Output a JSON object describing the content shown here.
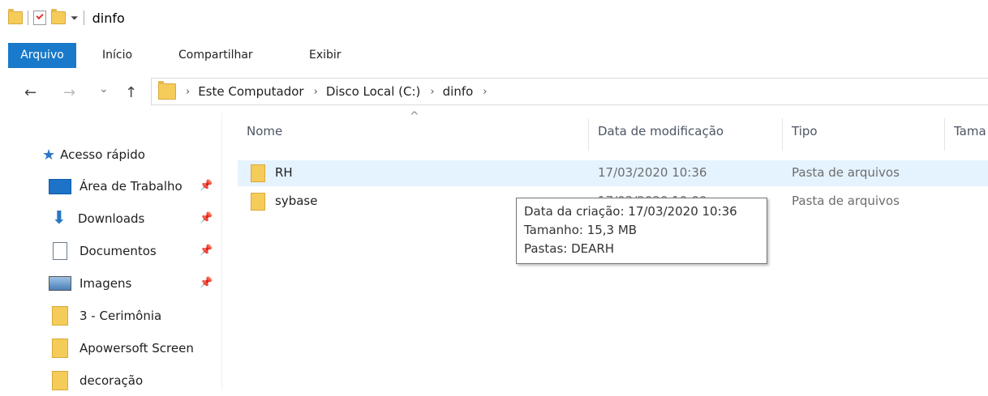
{
  "window": {
    "title": "dinfo"
  },
  "ribbon": {
    "tabs": [
      "Arquivo",
      "Início",
      "Compartilhar",
      "Exibir"
    ]
  },
  "nav_buttons": {
    "back": "←",
    "forward": "→",
    "recent": "⌄",
    "up": "↑"
  },
  "breadcrumb": [
    "Este Computador",
    "Disco Local (C:)",
    "dinfo"
  ],
  "breadcrumb_sep": "›",
  "sidebar": {
    "quick_access": "Acesso rápido",
    "items": [
      {
        "label": "Área de Trabalho",
        "icon": "desktop-icon",
        "pinned": true
      },
      {
        "label": "Downloads",
        "icon": "download-icon",
        "pinned": true
      },
      {
        "label": "Documentos",
        "icon": "documents-icon",
        "pinned": true
      },
      {
        "label": "Imagens",
        "icon": "pictures-icon",
        "pinned": true
      },
      {
        "label": "3 - Cerimônia",
        "icon": "folder-icon",
        "pinned": false
      },
      {
        "label": "Apowersoft Screen",
        "icon": "folder-icon",
        "pinned": false
      },
      {
        "label": "decoração",
        "icon": "folder-icon",
        "pinned": false
      }
    ]
  },
  "columns": {
    "name": "Nome",
    "modified": "Data de modificação",
    "type": "Tipo",
    "size": "Tama"
  },
  "sort_indicator": "^",
  "files": [
    {
      "name": "RH",
      "modified": "17/03/2020 10:36",
      "type": "Pasta de arquivos"
    },
    {
      "name": "sybase",
      "modified": "17/03/2020 10:00",
      "type": "Pasta de arquivos"
    }
  ],
  "tooltip": {
    "line1": "Data da criação: 17/03/2020 10:36",
    "line2": "Tamanho: 15,3 MB",
    "line3": "Pastas: DEARH"
  },
  "colors": {
    "accent": "#1979ca",
    "hover_row": "#e5f3ff",
    "folder": "#f5cc5a"
  }
}
